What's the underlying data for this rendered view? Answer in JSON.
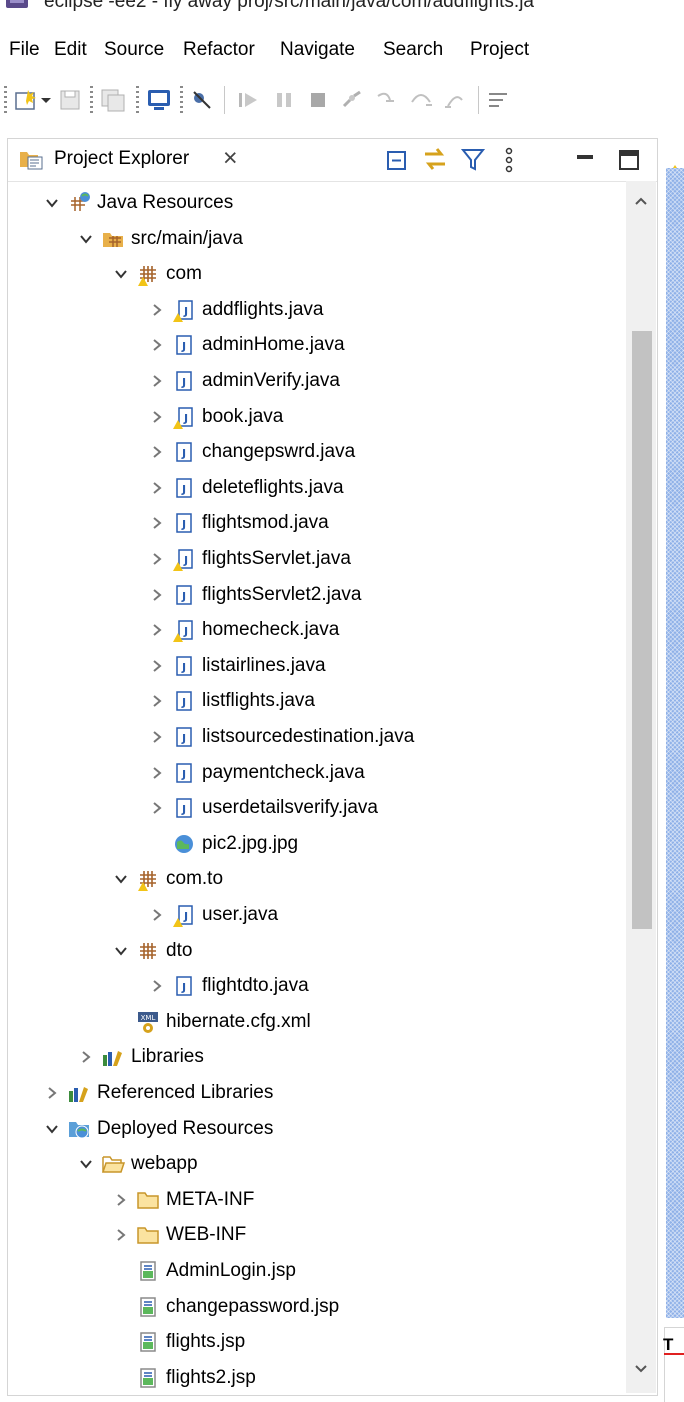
{
  "window": {
    "title": "eclipse -ee2 - fly away proj/src/main/java/com/addflights.ja"
  },
  "menu": [
    "File",
    "Edit",
    "Source",
    "Refactor",
    "Navigate",
    "Search",
    "Project"
  ],
  "toolbar": {
    "icons": [
      "new-wizard",
      "save",
      "save-all",
      "console",
      "skip-breakpoints",
      "resume",
      "suspend",
      "terminate",
      "disconnect",
      "step-into",
      "step-over",
      "step-return",
      "word-wrap"
    ]
  },
  "project_explorer": {
    "tab_label": "Project Explorer",
    "tab_close_glyph": "×",
    "view_actions": [
      "collapse-all",
      "link-with-editor",
      "filter",
      "view-menu",
      "minimize",
      "maximize"
    ],
    "tree": [
      {
        "label": "Java Resources",
        "level": 1,
        "expand": "open",
        "icon": "java-resources"
      },
      {
        "label": "src/main/java",
        "level": 2,
        "expand": "open",
        "icon": "source-folder"
      },
      {
        "label": "com",
        "level": 3,
        "expand": "open",
        "icon": "package-warning"
      },
      {
        "label": "addflights.java",
        "level": 4,
        "expand": "closed",
        "icon": "java-file-warning"
      },
      {
        "label": "adminHome.java",
        "level": 4,
        "expand": "closed",
        "icon": "java-file"
      },
      {
        "label": "adminVerify.java",
        "level": 4,
        "expand": "closed",
        "icon": "java-file"
      },
      {
        "label": "book.java",
        "level": 4,
        "expand": "closed",
        "icon": "java-file-warning"
      },
      {
        "label": "changepswrd.java",
        "level": 4,
        "expand": "closed",
        "icon": "java-file"
      },
      {
        "label": "deleteflights.java",
        "level": 4,
        "expand": "closed",
        "icon": "java-file"
      },
      {
        "label": "flightsmod.java",
        "level": 4,
        "expand": "closed",
        "icon": "java-file"
      },
      {
        "label": "flightsServlet.java",
        "level": 4,
        "expand": "closed",
        "icon": "java-file-warning"
      },
      {
        "label": "flightsServlet2.java",
        "level": 4,
        "expand": "closed",
        "icon": "java-file"
      },
      {
        "label": "homecheck.java",
        "level": 4,
        "expand": "closed",
        "icon": "java-file-warning"
      },
      {
        "label": "listairlines.java",
        "level": 4,
        "expand": "closed",
        "icon": "java-file"
      },
      {
        "label": "listflights.java",
        "level": 4,
        "expand": "closed",
        "icon": "java-file"
      },
      {
        "label": "listsourcedestination.java",
        "level": 4,
        "expand": "closed",
        "icon": "java-file"
      },
      {
        "label": "paymentcheck.java",
        "level": 4,
        "expand": "closed",
        "icon": "java-file"
      },
      {
        "label": "userdetailsverify.java",
        "level": 4,
        "expand": "closed",
        "icon": "java-file"
      },
      {
        "label": "pic2.jpg.jpg",
        "level": 4,
        "expand": "none",
        "icon": "image-file"
      },
      {
        "label": "com.to",
        "level": 3,
        "expand": "open",
        "icon": "package-warning"
      },
      {
        "label": "user.java",
        "level": 4,
        "expand": "closed",
        "icon": "java-file-warning"
      },
      {
        "label": "dto",
        "level": 3,
        "expand": "open",
        "icon": "package"
      },
      {
        "label": "flightdto.java",
        "level": 4,
        "expand": "closed",
        "icon": "java-file"
      },
      {
        "label": "hibernate.cfg.xml",
        "level": 3,
        "expand": "none",
        "icon": "xml-file"
      },
      {
        "label": "Libraries",
        "level": 2,
        "expand": "closed",
        "icon": "libraries"
      },
      {
        "label": "Referenced Libraries",
        "level": 1,
        "expand": "closed",
        "icon": "libraries"
      },
      {
        "label": "Deployed Resources",
        "level": 1,
        "expand": "open",
        "icon": "deployed-resources"
      },
      {
        "label": "webapp",
        "level": 2,
        "expand": "open",
        "icon": "folder-open"
      },
      {
        "label": "META-INF",
        "level": 3,
        "expand": "closed",
        "icon": "folder"
      },
      {
        "label": "WEB-INF",
        "level": 3,
        "expand": "closed",
        "icon": "folder"
      },
      {
        "label": "AdminLogin.jsp",
        "level": 3,
        "expand": "none",
        "icon": "jsp-file"
      },
      {
        "label": "changepassword.jsp",
        "level": 3,
        "expand": "none",
        "icon": "jsp-file"
      },
      {
        "label": "flights.jsp",
        "level": 3,
        "expand": "none",
        "icon": "jsp-file"
      },
      {
        "label": "flights2.jsp",
        "level": 3,
        "expand": "none",
        "icon": "jsp-file"
      }
    ]
  },
  "editor_partial": {
    "tab_fragment": "T"
  },
  "colors": {
    "package": "#b8741a",
    "java": "#2a5db0",
    "folder": "#e8b04a",
    "warning": "#f2c417",
    "editor_pattern": "#8fb1e8"
  }
}
